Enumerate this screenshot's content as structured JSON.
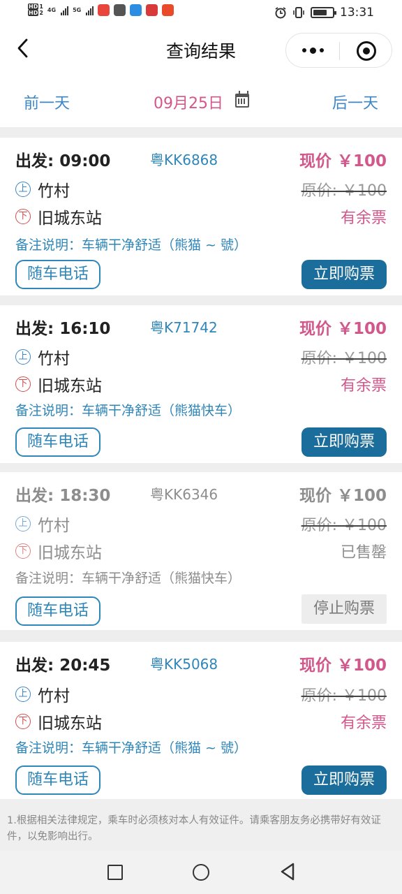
{
  "status_bar": {
    "hd_labels": [
      "HD",
      "HD"
    ],
    "sim_labels": [
      "1",
      "2"
    ],
    "net1": "4G",
    "net2": "5G",
    "time": "13:31"
  },
  "header": {
    "back_icon": "chevron-left",
    "title": "查询结果",
    "more_icon": "more-dots",
    "close_icon": "target-circle"
  },
  "date_nav": {
    "prev_label": "前一天",
    "date": "09月25日",
    "next_label": "后一天"
  },
  "trips": [
    {
      "depart": "出发: 09:00",
      "plate": "粤KK6868",
      "price": "现价 ￥100",
      "board_tag": "上",
      "board": "竹村",
      "original_price": "原价: ￥100",
      "alight_tag": "下",
      "alight": "旧城东站",
      "status": "有余票",
      "note": "备注说明：车辆干净舒适（熊猫 ~ 號）",
      "phone_label": "随车电话",
      "buy_label": "立即购票"
    },
    {
      "depart": "出发: 16:10",
      "plate": "粤K71742",
      "price": "现价 ￥100",
      "board_tag": "上",
      "board": "竹村",
      "original_price": "原价: ￥100",
      "alight_tag": "下",
      "alight": "旧城东站",
      "status": "有余票",
      "note": "备注说明：车辆干净舒适（熊猫快车）",
      "phone_label": "随车电话",
      "buy_label": "立即购票"
    },
    {
      "depart": "出发: 18:30",
      "plate": "粤KK6346",
      "price": "现价 ￥100",
      "board_tag": "上",
      "board": "竹村",
      "original_price": "原价: ￥100",
      "alight_tag": "下",
      "alight": "旧城东站",
      "status": "已售罄",
      "note": "备注说明：车辆干净舒适（熊猫快车）",
      "phone_label": "随车电话",
      "buy_label": "停止购票"
    },
    {
      "depart": "出发: 20:45",
      "plate": "粤KK5068",
      "price": "现价 ￥100",
      "board_tag": "上",
      "board": "竹村",
      "original_price": "原价: ￥100",
      "alight_tag": "下",
      "alight": "旧城东站",
      "status": "有余票",
      "note": "备注说明：车辆干净舒适（熊猫 ~ 號）",
      "phone_label": "随车电话",
      "buy_label": "立即购票"
    }
  ],
  "footnote": "1.根据相关法律规定，乘车时必须核对本人有效证件。请乘客朋友务必携带好有效证件，以免影响出行。",
  "colors": {
    "accent_blue": "#2f86b8",
    "buy_button": "#1b6e9b",
    "price_pink": "#d2578a",
    "disabled_gray": "#8d8d8d"
  }
}
